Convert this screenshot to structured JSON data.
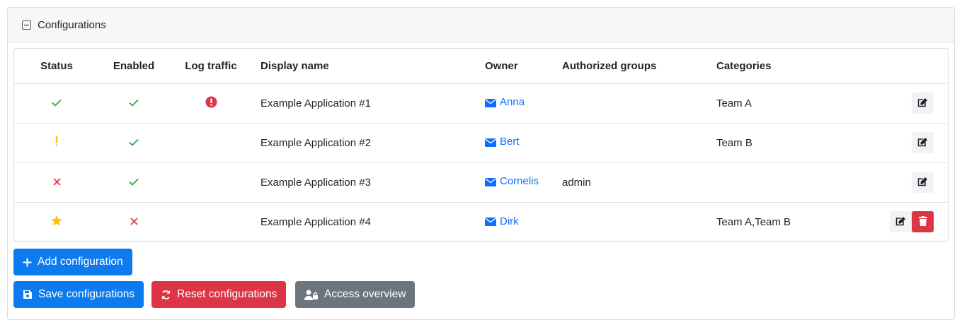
{
  "panel": {
    "title": "Configurations"
  },
  "table": {
    "headers": {
      "status": "Status",
      "enabled": "Enabled",
      "log_traffic": "Log traffic",
      "display_name": "Display name",
      "owner": "Owner",
      "authorized_groups": "Authorized groups",
      "categories": "Categories"
    },
    "rows": [
      {
        "status": "ok",
        "enabled": true,
        "log_traffic": "error",
        "display_name": "Example Application #1",
        "owner": "Anna",
        "authorized_groups": "",
        "categories": "Team A",
        "deletable": false
      },
      {
        "status": "warning",
        "enabled": true,
        "log_traffic": "",
        "display_name": "Example Application #2",
        "owner": "Bert",
        "authorized_groups": "",
        "categories": "Team B",
        "deletable": false
      },
      {
        "status": "error",
        "enabled": true,
        "log_traffic": "",
        "display_name": "Example Application #3",
        "owner": "Cornelis",
        "authorized_groups": "admin",
        "categories": "",
        "deletable": false
      },
      {
        "status": "new",
        "enabled": false,
        "log_traffic": "",
        "display_name": "Example Application #4",
        "owner": "Dirk",
        "authorized_groups": "",
        "categories": "Team A,Team B",
        "deletable": true
      }
    ]
  },
  "buttons": {
    "add": "Add configuration",
    "save": "Save configurations",
    "reset": "Reset configurations",
    "access": "Access overview"
  },
  "colors": {
    "primary": "#0d7bf0",
    "danger": "#dc3545",
    "secondary": "#6c757d",
    "success": "#28a745",
    "warning": "#ffc107",
    "link": "#0d6efd"
  }
}
